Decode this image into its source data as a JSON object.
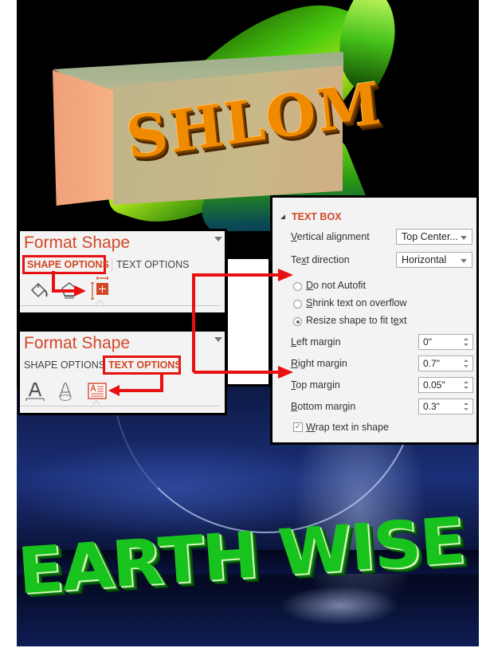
{
  "background": {
    "top_scene_text": "SHLOM",
    "bottom_scene_text": "EARTH WISE"
  },
  "format_shape_shape_options": {
    "title": "Format Shape",
    "tabs": [
      {
        "label": "SHAPE OPTIONS",
        "active": true
      },
      {
        "label": "TEXT OPTIONS",
        "active": false
      }
    ],
    "icons": [
      "fill-line-icon",
      "effects-icon",
      "size-properties-icon"
    ],
    "selected_icon": "size-properties-icon"
  },
  "format_shape_text_options": {
    "title": "Format Shape",
    "tabs": [
      {
        "label": "SHAPE OPTIONS",
        "active": false
      },
      {
        "label": "TEXT OPTIONS",
        "active": true
      }
    ],
    "icons": [
      "text-fill-outline-icon",
      "text-effects-icon",
      "textbox-icon"
    ],
    "selected_icon": "textbox-icon"
  },
  "text_box": {
    "section_title": "TEXT BOX",
    "vertical_alignment": {
      "label": "Vertical alignment",
      "value": "Top Center..."
    },
    "text_direction": {
      "label": "Text direction",
      "value": "Horizontal"
    },
    "autofit_options": [
      {
        "label": "Do not Autofit",
        "selected": false
      },
      {
        "label": "Shrink text on overflow",
        "selected": false
      },
      {
        "label": "Resize shape to fit text",
        "selected": true
      }
    ],
    "margins": [
      {
        "label": "Left margin",
        "value": "0\""
      },
      {
        "label": "Right margin",
        "value": "0.7\""
      },
      {
        "label": "Top margin",
        "value": "0.05\""
      },
      {
        "label": "Bottom margin",
        "value": "0.3\""
      }
    ],
    "wrap_text": {
      "label": "Wrap text in shape",
      "checked": true
    }
  },
  "colors": {
    "accent": "#d24726",
    "highlight": "#e81010"
  }
}
